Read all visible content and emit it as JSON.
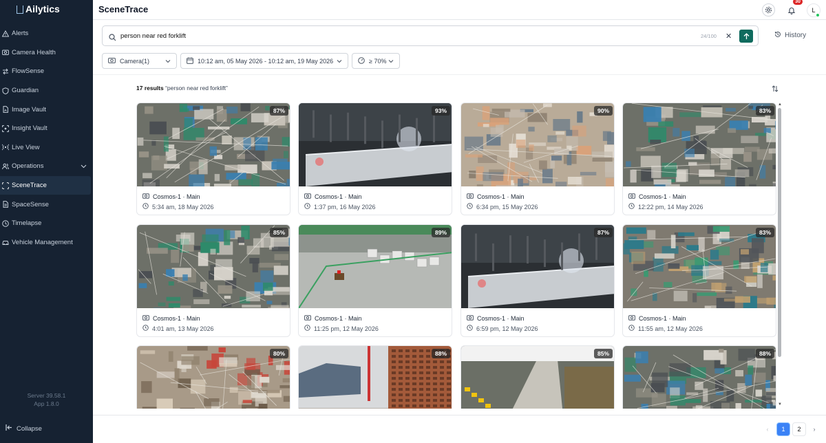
{
  "app": {
    "logo": "Ailytics"
  },
  "sidebar": {
    "items": [
      {
        "label": "Alerts",
        "icon": "alert-triangle-icon"
      },
      {
        "label": "Camera Health",
        "icon": "camera-icon"
      },
      {
        "label": "FlowSense",
        "icon": "flow-arrows-icon"
      },
      {
        "label": "Guardian",
        "icon": "shield-icon"
      },
      {
        "label": "Image Vault",
        "icon": "file-image-icon"
      },
      {
        "label": "Insight Vault",
        "icon": "scan-icon"
      },
      {
        "label": "Live View",
        "icon": "broadcast-icon"
      },
      {
        "label": "Operations",
        "icon": "users-icon"
      },
      {
        "label": "SceneTrace",
        "icon": "scan-frame-icon"
      },
      {
        "label": "SpaceSense",
        "icon": "file-grid-icon"
      },
      {
        "label": "Timelapse",
        "icon": "clock-icon"
      },
      {
        "label": "Vehicle Management",
        "icon": "car-icon"
      }
    ],
    "active": "SceneTrace",
    "server": "Server 39.58.1",
    "app_version": "App 1.8.0",
    "collapse": "Collapse"
  },
  "header": {
    "title": "SceneTrace",
    "notifications": "30",
    "avatar": "L"
  },
  "search": {
    "query": "person near red forklift",
    "counter": "24/100",
    "history": "History"
  },
  "filters": {
    "camera": "Camera(1)",
    "daterange": "10:12 am, 05 May 2026 - 10:12 am, 19 May 2026",
    "confidence": "≥ 70%"
  },
  "results": {
    "count": "17 results",
    "query_quoted": "“person near red forklift”"
  },
  "cards": [
    {
      "pct": "87%",
      "camera": "Cosmos-1 · Main",
      "time": "5:34 am, 18 May 2026",
      "scene": "day-site-a"
    },
    {
      "pct": "93%",
      "camera": "Cosmos-1 · Main",
      "time": "1:37 pm, 16 May 2026",
      "scene": "night-tunnel"
    },
    {
      "pct": "90%",
      "camera": "Cosmos-1 · Main",
      "time": "6:34 pm, 15 May 2026",
      "scene": "rebar-yard"
    },
    {
      "pct": "83%",
      "camera": "Cosmos-1 · Main",
      "time": "12:22 pm, 14 May 2026",
      "scene": "day-site-a"
    },
    {
      "pct": "85%",
      "camera": "Cosmos-1 · Main",
      "time": "4:01 am, 13 May 2026",
      "scene": "day-site-a"
    },
    {
      "pct": "89%",
      "camera": "Cosmos-1 · Main",
      "time": "11:25 pm, 12 May 2026",
      "scene": "forklift-yard"
    },
    {
      "pct": "87%",
      "camera": "Cosmos-1 · Main",
      "time": "6:59 pm, 12 May 2026",
      "scene": "night-tunnel"
    },
    {
      "pct": "83%",
      "camera": "Cosmos-1 · Main",
      "time": "11:55 am, 12 May 2026",
      "scene": "busy-site"
    },
    {
      "pct": "80%",
      "camera": "",
      "time": "",
      "scene": "red-site"
    },
    {
      "pct": "88%",
      "camera": "",
      "time": "",
      "scene": "tower-site"
    },
    {
      "pct": "85%",
      "camera": "",
      "time": "",
      "scene": "road-site"
    },
    {
      "pct": "88%",
      "camera": "",
      "time": "",
      "scene": "day-site-a"
    }
  ],
  "pagination": {
    "pages": [
      "1",
      "2"
    ],
    "current": "1"
  },
  "colors": {
    "sidebar": "#162232",
    "accent": "#0f6b5e",
    "page_active": "#3b82f6",
    "badge": "#dc2626"
  }
}
